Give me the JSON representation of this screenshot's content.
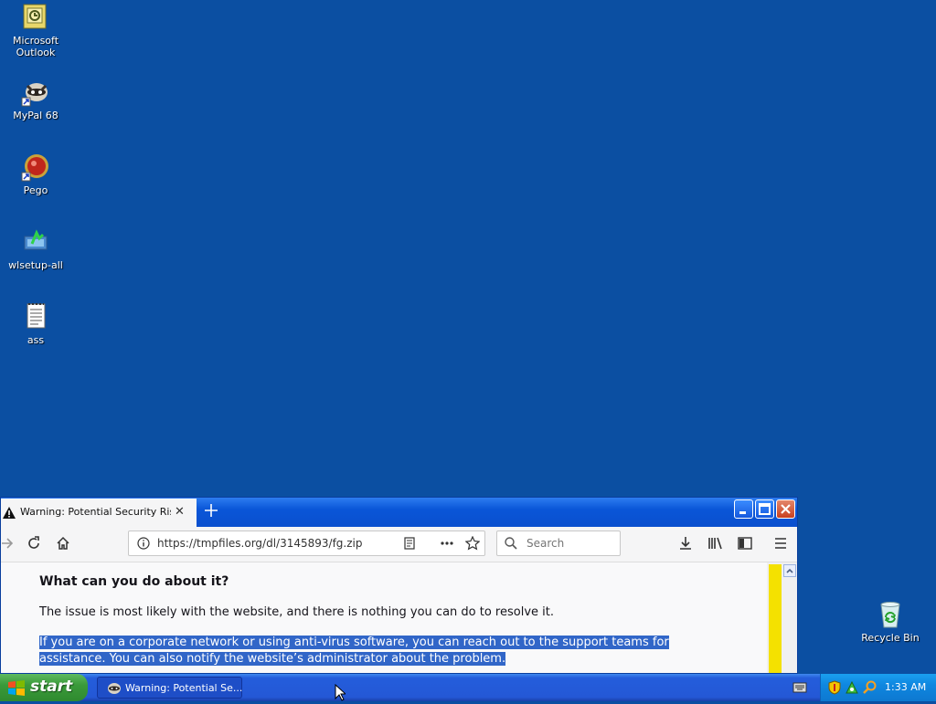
{
  "desktop": {
    "icons": [
      {
        "label": "Microsoft Outlook",
        "icon": "outlook-icon"
      },
      {
        "label": "MyPal 68",
        "icon": "mypal-icon"
      },
      {
        "label": "Pego",
        "icon": "pego-icon"
      },
      {
        "label": "wlsetup-all",
        "icon": "installer-icon"
      },
      {
        "label": "ass",
        "icon": "text-file-icon"
      },
      {
        "label": "Recycle Bin",
        "icon": "recycle-bin-icon"
      }
    ]
  },
  "browser": {
    "tab_title": "Warning: Potential Security Risk Ahead",
    "url": "https://tmpfiles.org/dl/3145893/fg.zip",
    "search_placeholder": "Search",
    "content": {
      "heading": "What can you do about it?",
      "paragraph1": "The issue is most likely with the website, and there is nothing you can do to resolve it.",
      "paragraph2": "If you are on a corporate network or using anti-virus software, you can reach out to the support teams for assistance. You can also notify the website’s administrator about the problem."
    }
  },
  "taskbar": {
    "start_label": "start",
    "task_label": "Warning: Potential Se...",
    "clock": "1:33 AM"
  },
  "colors": {
    "desktop_bg": "#0b4fa2",
    "selection": "#3166c8",
    "scroll_marker": "#f4e100"
  }
}
